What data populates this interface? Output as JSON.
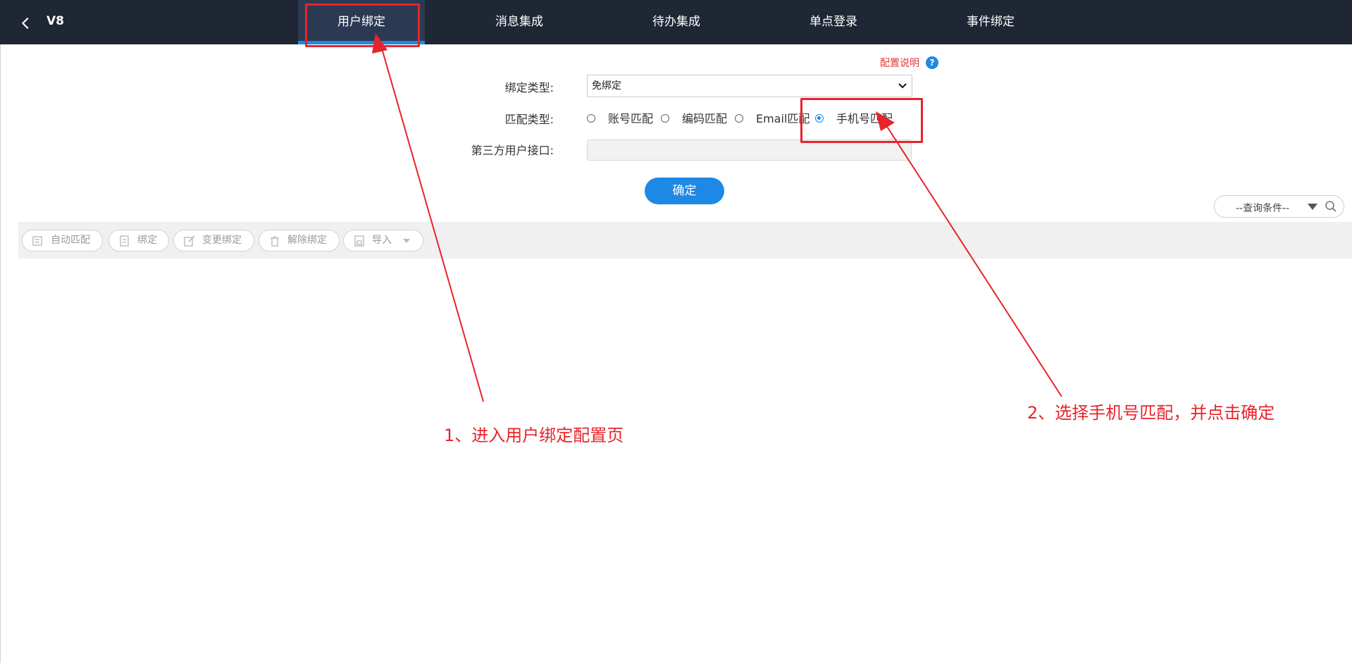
{
  "header": {
    "back_icon": "chevron-left-icon",
    "title": "V8",
    "tabs": [
      {
        "label": "用户绑定",
        "active": true
      },
      {
        "label": "消息集成",
        "active": false
      },
      {
        "label": "待办集成",
        "active": false
      },
      {
        "label": "单点登录",
        "active": false
      },
      {
        "label": "事件绑定",
        "active": false
      }
    ]
  },
  "config": {
    "help_link": "配置说明",
    "help_icon": "question-circle-icon",
    "bind_type_label": "绑定类型:",
    "bind_type_value": "免绑定",
    "match_type_label": "匹配类型:",
    "match_options": [
      {
        "label": "账号匹配",
        "checked": false
      },
      {
        "label": "编码匹配",
        "checked": false
      },
      {
        "label": "Email匹配",
        "checked": false
      },
      {
        "label": "手机号匹配",
        "checked": true
      }
    ],
    "third_party_label": "第三方用户接口:",
    "third_party_value": "",
    "confirm_label": "确定"
  },
  "query": {
    "placeholder": "--查询条件--",
    "search_icon": "search-icon"
  },
  "toolbar": {
    "buttons": [
      {
        "label": "自动匹配",
        "icon": "auto-match-icon"
      },
      {
        "label": "绑定",
        "icon": "bind-icon"
      },
      {
        "label": "变更绑定",
        "icon": "edit-bind-icon"
      },
      {
        "label": "解除绑定",
        "icon": "trash-icon"
      },
      {
        "label": "导入",
        "icon": "import-icon",
        "dropdown": true
      }
    ]
  },
  "annotations": {
    "step1": "1、进入用户绑定配置页",
    "step2": "2、选择手机号匹配，并点击确定"
  },
  "colors": {
    "topbar": "#1f2735",
    "active_tab": "#2b3a52",
    "accent": "#1e88e5",
    "annotation": "#e8232b",
    "help_link": "#e53935"
  }
}
